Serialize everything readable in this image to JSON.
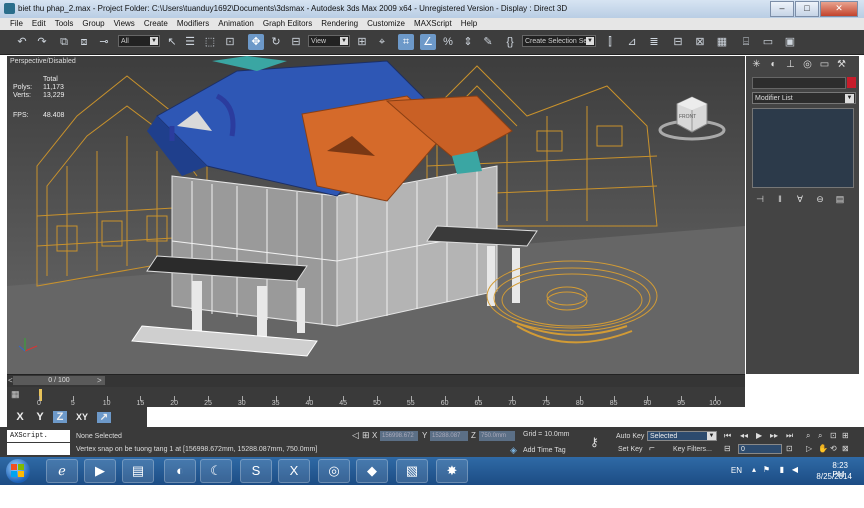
{
  "window": {
    "title": "biet thu phap_2.max    - Project Folder: C:\\Users\\tuanduy1692\\Documents\\3dsmax    - Autodesk 3ds Max  2009 x64  - Unregistered Version    - Display : Direct 3D",
    "controls": [
      "–",
      "□",
      "✕"
    ]
  },
  "menu": [
    "File",
    "Edit",
    "Tools",
    "Group",
    "Views",
    "Create",
    "Modifiers",
    "Animation",
    "Graph Editors",
    "Rendering",
    "Customize",
    "MAXScript",
    "Help"
  ],
  "toolbar": {
    "selection_filter": "All",
    "ref_coord": "View",
    "named_selection": "Create Selection Set"
  },
  "viewport": {
    "label": "Perspective/Disabled",
    "stats": {
      "total_label": "Total",
      "polys_label": "Polys:",
      "polys": "11,173",
      "verts_label": "Verts:",
      "verts": "13,229",
      "fps_label": "FPS:",
      "fps": "48.408"
    },
    "viewcube_label": "FRONT"
  },
  "command_panel": {
    "modifier_list": "Modifier List"
  },
  "time_slider": {
    "frame": "0 / 100",
    "ticks": [
      "0",
      "5",
      "10",
      "15",
      "20",
      "25",
      "30",
      "35",
      "40",
      "45",
      "50",
      "55",
      "60",
      "65",
      "70",
      "75",
      "80",
      "85",
      "90",
      "95",
      "100"
    ]
  },
  "axis": [
    "X",
    "Y",
    "Z",
    "XY"
  ],
  "status": {
    "maxscript": "AXScript.",
    "selection": "None Selected",
    "prompt": "Vertex snap on be tuong tang 1 at [156998.672mm, 15288.087mm, 750.0mm]",
    "x_label": "X",
    "x_value": "156998.672",
    "y_label": "Y",
    "y_value": "15288.087",
    "z_label": "Z",
    "z_value": "750.0mm",
    "grid": "Grid = 10.0mm",
    "add_time_tag": "Add Time Tag",
    "auto_key": "Auto Key",
    "set_key": "Set Key",
    "key_mode": "Selected",
    "key_filters": "Key Filters...",
    "current_frame": "0"
  },
  "taskbar": {
    "language": "EN",
    "time": "8:23 PM",
    "date": "8/25/2014"
  }
}
